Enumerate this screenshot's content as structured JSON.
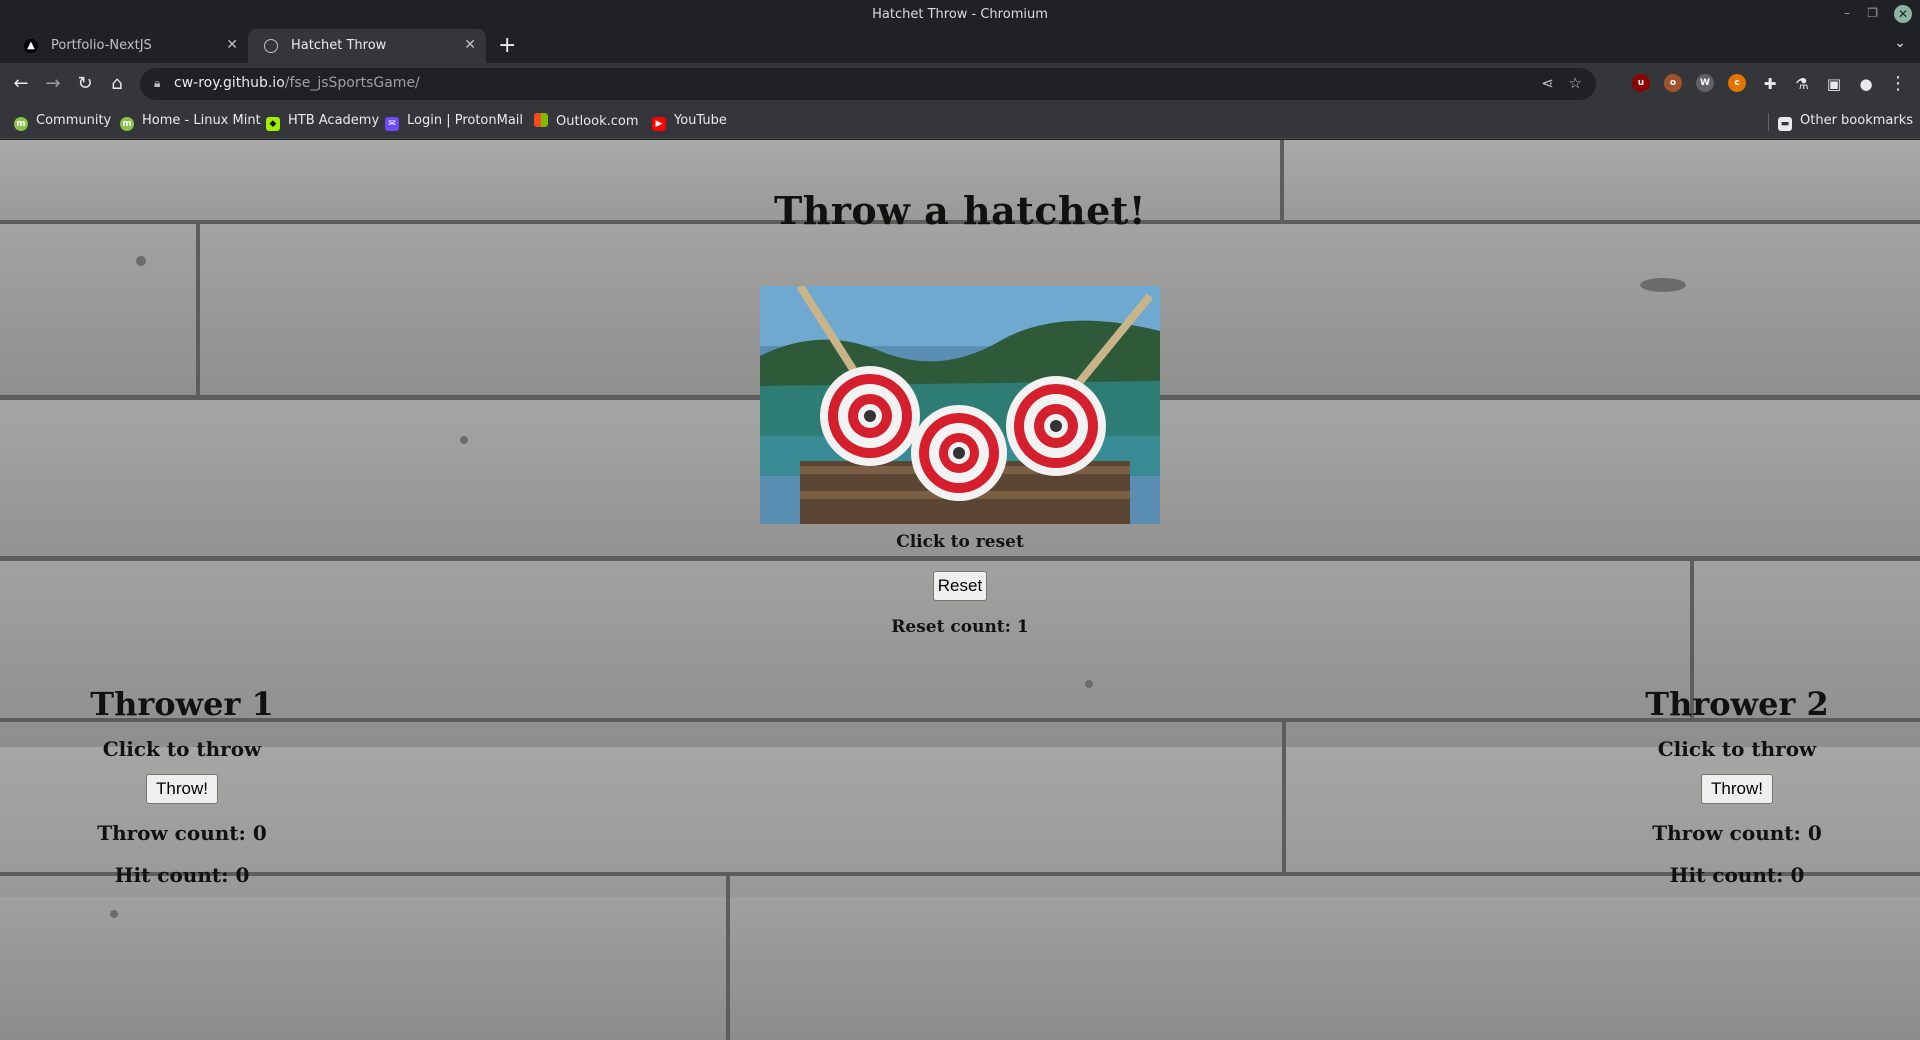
{
  "window": {
    "title": "Hatchet Throw - Chromium"
  },
  "tabs": [
    {
      "label": "Portfolio-NextJS",
      "active": false
    },
    {
      "label": "Hatchet Throw",
      "active": true
    }
  ],
  "address": {
    "host": "cw-roy.github.io",
    "path": "/fse_jsSportsGame/"
  },
  "bookmarks": [
    {
      "label": "Community",
      "icon": "mint-icon",
      "color": "#8bc34a"
    },
    {
      "label": "Home - Linux Mint",
      "icon": "mint-icon",
      "color": "#8bc34a"
    },
    {
      "label": "HTB Academy",
      "icon": "cube-icon",
      "color": "#9fef00"
    },
    {
      "label": "Login | ProtonMail",
      "icon": "proton-icon",
      "color": "#6d4aff"
    },
    {
      "label": "Outlook.com",
      "icon": "windows-icon",
      "color": "#f25022"
    },
    {
      "label": "YouTube",
      "icon": "youtube-icon",
      "color": "#ff0000"
    }
  ],
  "other_bookmarks": "Other bookmarks",
  "page": {
    "heading": "Throw a hatchet!",
    "reset_caption": "Click to reset",
    "reset_button": "Reset",
    "reset_count": "Reset count: 1",
    "players": [
      {
        "name": "Thrower 1",
        "caption": "Click to throw",
        "button": "Throw!",
        "throw_count": "Throw count: 0",
        "hit_count": "Hit count: 0"
      },
      {
        "name": "Thrower 2",
        "caption": "Click to throw",
        "button": "Throw!",
        "throw_count": "Throw count: 0",
        "hit_count": "Hit count: 0"
      }
    ]
  }
}
